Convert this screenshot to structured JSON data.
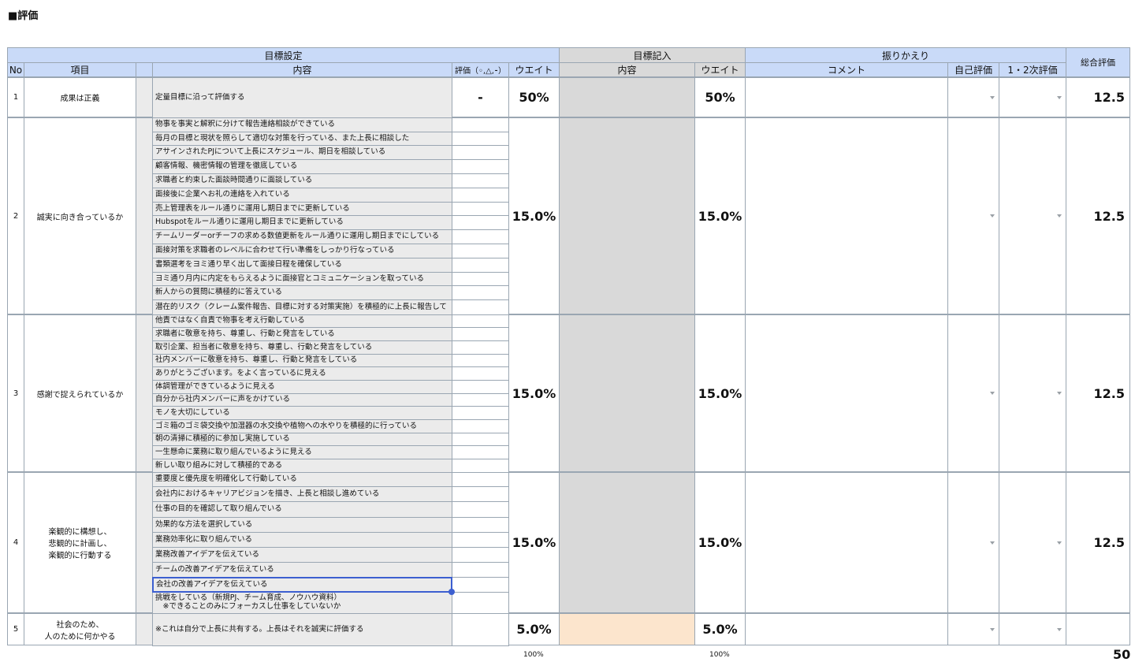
{
  "title": "■評価",
  "headers": {
    "group_goal_setting": "目標設定",
    "group_goal_entry": "目標記入",
    "group_review": "振りかえり",
    "overall": "総合評価",
    "no": "No",
    "item": "項目",
    "content": "内容",
    "eval_mark": "評価（◦,△,⁃）",
    "weight": "ウエイト",
    "entry_content": "内容",
    "entry_weight": "ウエイト",
    "comment": "コメント",
    "self_eval": "自己評価",
    "second_eval": "1・2次評価"
  },
  "rows": [
    {
      "no": "1",
      "item": "成果は正義",
      "lines": [
        "定量目標に沿って評価する"
      ],
      "mark": "-",
      "weight": "50%",
      "entry_weight": "50%",
      "total": "12.5"
    },
    {
      "no": "2",
      "item": "誠実に向き合っているか",
      "lines": [
        "物事を事実と解釈に分けて報告連絡相談ができている",
        "毎月の目標と現状を照らして適切な対策を行っている、また上長に相談した",
        "アサインされたPJについて上長にスケジュール、期日を相談している",
        "顧客情報、機密情報の管理を徹底している",
        "求職者と約束した面談時間通りに面談している",
        "面接後に企業へお礼の連絡を入れている",
        "売上管理表をルール通りに運用し期日までに更新している",
        "Hubspotをルール通りに運用し期日までに更新している",
        "チームリーダーorチーフの求める数値更新をルール通りに運用し期日までにしている",
        "面接対策を求職者のレベルに合わせて行い準備をしっかり行なっている",
        "書類選考をヨミ通り早く出して面接日程を確保している",
        "ヨミ通り月内に内定をもらえるように面接官とコミュニケーションを取っている",
        "新人からの質問に積極的に答えている",
        "潜在的リスク（クレーム案件報告、目標に対する対策実施）を積極的に上長に報告して"
      ],
      "weight": "15.0%",
      "entry_weight": "15.0%",
      "total": "12.5"
    },
    {
      "no": "3",
      "item": "感謝で捉えられているか",
      "lines": [
        "他責ではなく自責で物事を考え行動している",
        "求職者に敬意を持ち、尊重し、行動と発言をしている",
        "取引企業、担当者に敬意を持ち、尊重し、行動と発言をしている",
        "社内メンバーに敬意を持ち、尊重し、行動と発言をしている",
        "ありがとうございます。をよく言っているに見える",
        "体調管理ができているように見える",
        "自分から社内メンバーに声をかけている",
        "モノを大切にしている",
        "ゴミ箱のゴミ袋交換や加湿器の水交換や植物への水やりを積極的に行っている",
        "朝の清掃に積極的に参加し実施している",
        "一生懸命に業務に取り組んでいるように見える",
        "新しい取り組みに対して積極的である"
      ],
      "weight": "15.0%",
      "entry_weight": "15.0%",
      "total": "12.5"
    },
    {
      "no": "4",
      "item": "楽観的に構想し、\n悲観的に計画し、\n楽観的に行動する",
      "lines": [
        "重要度と優先度を明確化して行動している",
        "会社内におけるキャリアビジョンを描き、上長と相談し進めている",
        "仕事の目的を確認して取り組んでいる",
        "効果的な方法を選択している",
        "業務効率化に取り組んでいる",
        "業務改善アイデアを伝えている",
        "チームの改善アイデアを伝えている",
        "会社の改善アイデアを伝えている",
        "挑戦をしている（新規PJ、チーム育成、ノウハウ資料）\n　※できることのみにフォーカスし仕事をしていないか"
      ],
      "weight": "15.0%",
      "entry_weight": "15.0%",
      "total": "12.5"
    },
    {
      "no": "5",
      "item": "社会のため、\n人のために何かやる",
      "lines": [
        "※これは自分で上長に共有する。上長はそれを誠実に評価する"
      ],
      "weight": "5.0%",
      "entry_weight": "5.0%",
      "total": ""
    }
  ],
  "footer": {
    "weight_total": "100%",
    "entry_weight_total": "100%",
    "grand_total": "50"
  }
}
